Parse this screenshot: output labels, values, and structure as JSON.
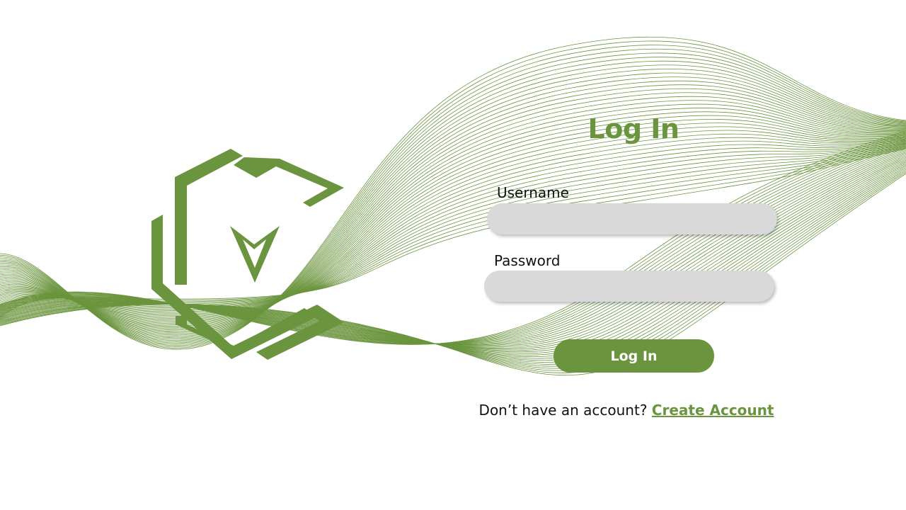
{
  "page": {
    "title": "Log In"
  },
  "form": {
    "username_label": "Username",
    "username_value": "",
    "password_label": "Password",
    "password_value": "",
    "submit_label": "Log In"
  },
  "footer": {
    "prompt_text": "Don’t have an account?",
    "create_account_label": "Create Account"
  },
  "theme": {
    "accent": "#6a943d",
    "field_bg": "#d9d9d9",
    "background": "#ffffff"
  },
  "icons": {
    "logo": "hexagon-chevron-logo-icon",
    "background": "wave-lines-decoration"
  }
}
